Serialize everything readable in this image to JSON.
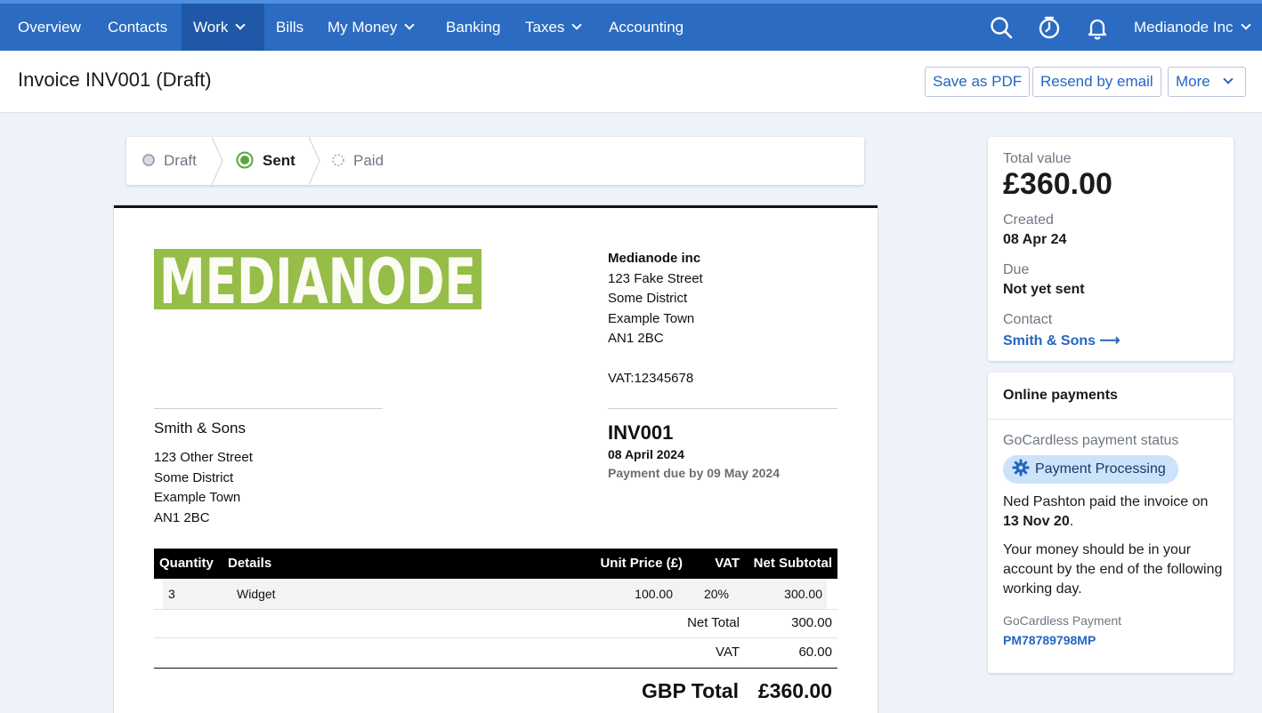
{
  "nav": {
    "items": [
      {
        "label": "Overview"
      },
      {
        "label": "Contacts"
      },
      {
        "label": "Work"
      },
      {
        "label": "Bills"
      },
      {
        "label": "My Money"
      },
      {
        "label": "Banking"
      },
      {
        "label": "Taxes"
      },
      {
        "label": "Accounting"
      }
    ],
    "active": "Work",
    "account_label": "Medianode Inc",
    "icons": [
      "search-icon",
      "timer-icon",
      "bell-icon"
    ]
  },
  "header": {
    "title": "Invoice INV001 (Draft)",
    "save_pdf_label": "Save as PDF",
    "resend_label": "Resend by email",
    "more_label": "More"
  },
  "stepper": {
    "steps": [
      {
        "label": "Draft",
        "state": "done"
      },
      {
        "label": "Sent",
        "state": "current"
      },
      {
        "label": "Paid",
        "state": "pending"
      }
    ],
    "accent_color": "#5aa83a"
  },
  "invoice": {
    "logo_text": "MEDIANODE",
    "logo_color": "#96bd48",
    "sender": {
      "name": "Medianode inc",
      "address_lines": [
        "123 Fake Street",
        "Some District",
        "Example Town",
        "AN1 2BC"
      ],
      "vat": "VAT:12345678"
    },
    "recipient": {
      "name": "Smith & Sons",
      "address_lines": [
        "123 Other Street",
        "Some District",
        "Example Town",
        "AN1 2BC"
      ]
    },
    "number": "INV001",
    "date": "08 April 2024",
    "due": "Payment due by 09 May 2024",
    "columns": [
      "Quantity",
      "Details",
      "Unit Price (£)",
      "VAT",
      "Net Subtotal"
    ],
    "rows": [
      {
        "quantity": "3",
        "details": "Widget",
        "unit_price": "100.00",
        "vat": "20%",
        "net_subtotal": "300.00"
      }
    ],
    "net_total_label": "Net Total",
    "net_total": "300.00",
    "vat_label": "VAT",
    "vat_total": "60.00",
    "grand_label": "GBP Total",
    "grand_total": "£360.00"
  },
  "summary": {
    "total_label": "Total value",
    "total_value": "£360.00",
    "created_label": "Created",
    "created_value": "08 Apr 24",
    "due_label": "Due",
    "due_value": "Not yet sent",
    "contact_label": "Contact",
    "contact_value": "Smith & Sons ⟶"
  },
  "payments": {
    "title": "Online payments",
    "status_label": "GoCardless payment status",
    "status_badge": "Payment Processing",
    "paid_text": "Ned Pashton paid the invoice on",
    "paid_date": "13 Nov 20",
    "paid_suffix": ".",
    "info_text": "Your money should be in your account by the end of the following working day.",
    "payment_label": "GoCardless Payment",
    "payment_id": "PM78789798MP"
  }
}
